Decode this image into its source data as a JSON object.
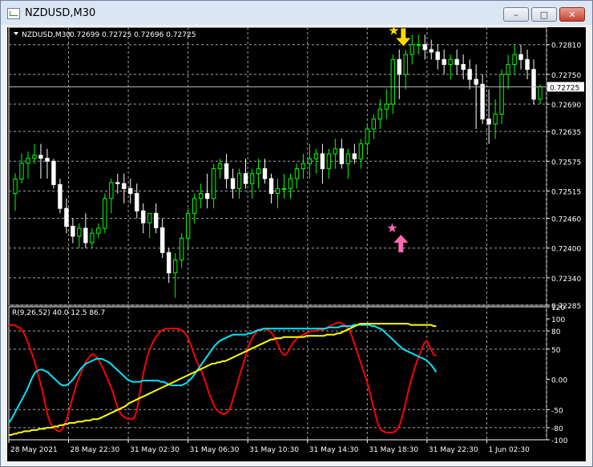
{
  "window": {
    "title": "NZDUSD,M30",
    "buttons": {
      "minimize": "–",
      "maximize": "□",
      "close": "✕"
    }
  },
  "chart_data": [
    {
      "type": "candlestick",
      "symbol_label": "NZDUSD,M30",
      "ohlc_header": "0.72699 0.72725 0.72696 0.72725",
      "current_price_label": "0.72725",
      "current_price": 0.72725,
      "ylim": [
        0.72285,
        0.72845
      ],
      "y_ticks": [
        "0.72810",
        "0.72750",
        "0.72690",
        "0.72635",
        "0.72575",
        "0.72515",
        "0.72460",
        "0.72400",
        "0.72340",
        "0.72285"
      ],
      "y_tick_values": [
        0.7281,
        0.7275,
        0.7269,
        0.72635,
        0.72575,
        0.72515,
        0.7246,
        0.724,
        0.7234,
        0.72285
      ],
      "grid": true,
      "colors": {
        "background": "#000000",
        "bull": "#00ff00",
        "bear": "#ffffff",
        "grid": "#9aa8a8",
        "axis": "#ffffff"
      },
      "candles": [
        [
          0.7251,
          0.72551,
          0.72475,
          0.72539
        ],
        [
          0.72539,
          0.72591,
          0.7253,
          0.72571
        ],
        [
          0.72571,
          0.72595,
          0.7254,
          0.72581
        ],
        [
          0.72581,
          0.7261,
          0.7257,
          0.72587
        ],
        [
          0.72587,
          0.7261,
          0.7254,
          0.72581
        ],
        [
          0.72581,
          0.726,
          0.7254,
          0.72575
        ],
        [
          0.72575,
          0.7258,
          0.7252,
          0.72528
        ],
        [
          0.72528,
          0.7254,
          0.7247,
          0.7248
        ],
        [
          0.7248,
          0.725,
          0.7243,
          0.72444
        ],
        [
          0.72444,
          0.7246,
          0.7241,
          0.72424
        ],
        [
          0.72424,
          0.7245,
          0.724,
          0.7244
        ],
        [
          0.7244,
          0.7247,
          0.724,
          0.72411
        ],
        [
          0.72411,
          0.7244,
          0.724,
          0.7243
        ],
        [
          0.7243,
          0.7245,
          0.7242,
          0.7244
        ],
        [
          0.7244,
          0.7251,
          0.7243,
          0.725
        ],
        [
          0.725,
          0.7254,
          0.7247,
          0.72532
        ],
        [
          0.72532,
          0.7255,
          0.7251,
          0.7253
        ],
        [
          0.7253,
          0.7255,
          0.7249,
          0.7252
        ],
        [
          0.7252,
          0.7254,
          0.7249,
          0.7251
        ],
        [
          0.7251,
          0.7253,
          0.7246,
          0.72475
        ],
        [
          0.72475,
          0.7249,
          0.7243,
          0.72451
        ],
        [
          0.72451,
          0.7247,
          0.7242,
          0.7247
        ],
        [
          0.7247,
          0.7249,
          0.7243,
          0.72441
        ],
        [
          0.72441,
          0.7246,
          0.7238,
          0.72391
        ],
        [
          0.72391,
          0.724,
          0.7233,
          0.7235
        ],
        [
          0.7235,
          0.7239,
          0.723,
          0.72376
        ],
        [
          0.72376,
          0.7243,
          0.7236,
          0.7242
        ],
        [
          0.7242,
          0.7248,
          0.724,
          0.7247
        ],
        [
          0.7247,
          0.7251,
          0.7245,
          0.725
        ],
        [
          0.725,
          0.7253,
          0.7248,
          0.7251
        ],
        [
          0.7251,
          0.7255,
          0.7248,
          0.725
        ],
        [
          0.725,
          0.7257,
          0.7248,
          0.7256
        ],
        [
          0.7256,
          0.7258,
          0.7254,
          0.7257
        ],
        [
          0.7257,
          0.7259,
          0.7252,
          0.7254
        ],
        [
          0.7254,
          0.7256,
          0.725,
          0.7252
        ],
        [
          0.7252,
          0.7256,
          0.725,
          0.7255
        ],
        [
          0.7255,
          0.7258,
          0.7252,
          0.7253
        ],
        [
          0.7253,
          0.7256,
          0.725,
          0.7255
        ],
        [
          0.7255,
          0.7258,
          0.7252,
          0.7256
        ],
        [
          0.7256,
          0.7258,
          0.7253,
          0.7254
        ],
        [
          0.7254,
          0.7255,
          0.7249,
          0.7251
        ],
        [
          0.7251,
          0.7254,
          0.7248,
          0.7252
        ],
        [
          0.7252,
          0.7255,
          0.725,
          0.7252
        ],
        [
          0.7252,
          0.7255,
          0.725,
          0.7254
        ],
        [
          0.7254,
          0.7257,
          0.7252,
          0.7256
        ],
        [
          0.7256,
          0.7259,
          0.7254,
          0.7257
        ],
        [
          0.7257,
          0.7261,
          0.7254,
          0.7258
        ],
        [
          0.7258,
          0.726,
          0.7255,
          0.7259
        ],
        [
          0.7259,
          0.7261,
          0.7253,
          0.7256
        ],
        [
          0.7256,
          0.726,
          0.7254,
          0.7259
        ],
        [
          0.7259,
          0.7262,
          0.7256,
          0.726
        ],
        [
          0.726,
          0.7262,
          0.7256,
          0.7257
        ],
        [
          0.7257,
          0.726,
          0.7254,
          0.7259
        ],
        [
          0.7259,
          0.7261,
          0.7257,
          0.7258
        ],
        [
          0.7258,
          0.7262,
          0.7256,
          0.7261
        ],
        [
          0.7261,
          0.7265,
          0.7259,
          0.7264
        ],
        [
          0.7264,
          0.7267,
          0.7262,
          0.7266
        ],
        [
          0.7266,
          0.727,
          0.7264,
          0.7268
        ],
        [
          0.7268,
          0.7272,
          0.7266,
          0.7269
        ],
        [
          0.7269,
          0.7279,
          0.7267,
          0.7278
        ],
        [
          0.7278,
          0.728,
          0.727,
          0.7275
        ],
        [
          0.7275,
          0.728,
          0.7272,
          0.7279
        ],
        [
          0.7279,
          0.7283,
          0.7277,
          0.7281
        ],
        [
          0.7281,
          0.7283,
          0.7279,
          0.7281
        ],
        [
          0.7281,
          0.7283,
          0.7278,
          0.728
        ],
        [
          0.728,
          0.7282,
          0.7278,
          0.72795
        ],
        [
          0.72795,
          0.7281,
          0.7276,
          0.7278
        ],
        [
          0.7278,
          0.728,
          0.7275,
          0.7277
        ],
        [
          0.7277,
          0.7279,
          0.7274,
          0.7278
        ],
        [
          0.7278,
          0.728,
          0.7275,
          0.7277
        ],
        [
          0.7277,
          0.7279,
          0.7274,
          0.7276
        ],
        [
          0.7276,
          0.7278,
          0.7272,
          0.7274
        ],
        [
          0.7274,
          0.7277,
          0.7264,
          0.7273
        ],
        [
          0.7273,
          0.7275,
          0.7265,
          0.7266
        ],
        [
          0.7266,
          0.7272,
          0.7261,
          0.7265
        ],
        [
          0.7265,
          0.727,
          0.7262,
          0.7267
        ],
        [
          0.7267,
          0.7276,
          0.7265,
          0.7275
        ],
        [
          0.7275,
          0.7279,
          0.7272,
          0.7277
        ],
        [
          0.7277,
          0.7281,
          0.7275,
          0.7279
        ],
        [
          0.7279,
          0.7281,
          0.7276,
          0.7278
        ],
        [
          0.7278,
          0.728,
          0.7274,
          0.7276
        ],
        [
          0.7276,
          0.7278,
          0.7269,
          0.727
        ],
        [
          0.727,
          0.7273,
          0.7269,
          0.72725
        ]
      ],
      "signals": [
        {
          "kind": "buy",
          "candle_index": 59,
          "price": 0.7244,
          "star_color": "#ff69b4",
          "arrow_color": "#ff69b4"
        },
        {
          "kind": "sell",
          "candle_index": 60,
          "price": 0.7282,
          "star_color": "#ffd700",
          "arrow_color": "#ffd700"
        }
      ]
    },
    {
      "type": "line",
      "label": "R(9,26,52) 40.0 12.5 86.7",
      "ylim": [
        -100,
        120
      ],
      "y_ticks": [
        "120",
        "100",
        "80",
        "50",
        "0.00",
        "-50",
        "-80",
        "-100"
      ],
      "y_tick_values": [
        120,
        100,
        80,
        50,
        0,
        -50,
        -80,
        -100
      ],
      "levels": [
        80,
        50,
        -50,
        -80
      ],
      "x_labels": [
        "28 May 2021",
        "28 May 22:30",
        "31 May 02:30",
        "31 May 06:30",
        "31 May 10:30",
        "31 May 14:30",
        "31 May 18:30",
        "31 May 22:30",
        "1 Jun 02:30"
      ],
      "series": [
        {
          "color": "#ff0000",
          "values": [
            88,
            90,
            90,
            88,
            86,
            84,
            78,
            70,
            60,
            48,
            38,
            24,
            10,
            -5,
            -20,
            -40,
            -58,
            -70,
            -78,
            -82,
            -85,
            -86,
            -83,
            -76,
            -66,
            -52,
            -36,
            -22,
            -8,
            2,
            12,
            22,
            30,
            35,
            40,
            42,
            38,
            34,
            26,
            18,
            8,
            0,
            -10,
            -20,
            -34,
            -46,
            -55,
            -60,
            -63,
            -65,
            -65,
            -66,
            -63,
            -52,
            -28,
            -4,
            16,
            32,
            46,
            56,
            64,
            70,
            76,
            80,
            82,
            84,
            84,
            84,
            84,
            84,
            84,
            82,
            80,
            76,
            70,
            60,
            50,
            38,
            28,
            20,
            12,
            0,
            -12,
            -24,
            -34,
            -44,
            -50,
            -54,
            -56,
            -58,
            -56,
            -52,
            -44,
            -30,
            -16,
            -2,
            12,
            24,
            38,
            52,
            62,
            70,
            76,
            80,
            82,
            84,
            84,
            82,
            80,
            76,
            70,
            62,
            52,
            44,
            40,
            42,
            48,
            56,
            62,
            66,
            70,
            72,
            74,
            76,
            78,
            80,
            80,
            80,
            82,
            82,
            82,
            84,
            86,
            88,
            90,
            92,
            94,
            94,
            92,
            90,
            86,
            82,
            72,
            60,
            48,
            36,
            24,
            12,
            0,
            -14,
            -30,
            -46,
            -62,
            -76,
            -84,
            -86,
            -88,
            -88,
            -88,
            -88,
            -86,
            -82,
            -74,
            -60,
            -44,
            -26,
            -10,
            4,
            18,
            30,
            40,
            50,
            60,
            64,
            56,
            48,
            40,
            40
          ]
        },
        {
          "color": "#00e5ff",
          "values": [
            -72,
            -66,
            -58,
            -50,
            -42,
            -34,
            -26,
            -18,
            -8,
            2,
            10,
            14,
            16,
            16,
            14,
            12,
            8,
            4,
            0,
            -4,
            -8,
            -10,
            -10,
            -8,
            -4,
            0,
            6,
            12,
            18,
            22,
            26,
            28,
            30,
            32,
            34,
            34,
            34,
            32,
            30,
            28,
            24,
            20,
            16,
            12,
            8,
            4,
            0,
            -2,
            -4,
            -4,
            -4,
            -4,
            -2,
            -2,
            -2,
            -2,
            -2,
            -2,
            -2,
            -4,
            -4,
            -6,
            -8,
            -10,
            -10,
            -10,
            -10,
            -10,
            -8,
            -6,
            -2,
            2,
            8,
            14,
            20,
            26,
            32,
            38,
            44,
            50,
            56,
            60,
            64,
            66,
            68,
            70,
            72,
            74,
            74,
            74,
            74,
            74,
            74,
            76,
            76,
            78,
            80,
            82,
            82,
            84,
            84,
            84,
            84,
            84,
            84,
            84,
            84,
            84,
            84,
            84,
            84,
            84,
            84,
            84,
            84,
            84,
            84,
            84,
            84,
            84,
            84,
            84,
            84,
            84,
            86,
            86,
            86,
            86,
            86,
            88,
            88,
            88,
            88,
            88,
            90,
            90,
            90,
            90,
            90,
            90,
            90,
            88,
            88,
            86,
            84,
            82,
            78,
            74,
            70,
            66,
            62,
            58,
            54,
            50,
            48,
            46,
            44,
            42,
            40,
            38,
            36,
            34,
            32,
            28,
            24,
            18,
            12
          ]
        },
        {
          "color": "#ffff00",
          "values": [
            -92,
            -92,
            -90,
            -90,
            -88,
            -88,
            -86,
            -86,
            -86,
            -84,
            -84,
            -84,
            -82,
            -82,
            -82,
            -80,
            -80,
            -80,
            -78,
            -78,
            -76,
            -76,
            -74,
            -74,
            -72,
            -72,
            -72,
            -70,
            -70,
            -70,
            -68,
            -68,
            -68,
            -66,
            -66,
            -66,
            -64,
            -62,
            -60,
            -58,
            -56,
            -54,
            -52,
            -50,
            -48,
            -46,
            -44,
            -40,
            -38,
            -36,
            -34,
            -32,
            -30,
            -28,
            -26,
            -24,
            -22,
            -20,
            -18,
            -16,
            -14,
            -12,
            -10,
            -8,
            -6,
            -4,
            -2,
            0,
            2,
            4,
            6,
            8,
            10,
            12,
            14,
            16,
            18,
            20,
            22,
            24,
            26,
            26,
            28,
            28,
            30,
            30,
            32,
            34,
            36,
            38,
            40,
            42,
            44,
            46,
            48,
            50,
            52,
            54,
            56,
            58,
            60,
            62,
            64,
            66,
            66,
            68,
            68,
            68,
            70,
            70,
            70,
            70,
            70,
            70,
            70,
            70,
            70,
            72,
            72,
            72,
            72,
            72,
            72,
            72,
            72,
            74,
            74,
            74,
            74,
            76,
            76,
            78,
            80,
            82,
            84,
            86,
            88,
            90,
            92,
            92,
            92,
            92,
            92,
            92,
            92,
            92,
            92,
            92,
            92,
            92,
            92,
            92,
            92,
            92,
            92,
            92,
            92,
            92,
            90,
            90,
            90,
            90,
            90,
            90,
            90,
            90,
            90,
            88,
            88
          ]
        }
      ]
    }
  ]
}
